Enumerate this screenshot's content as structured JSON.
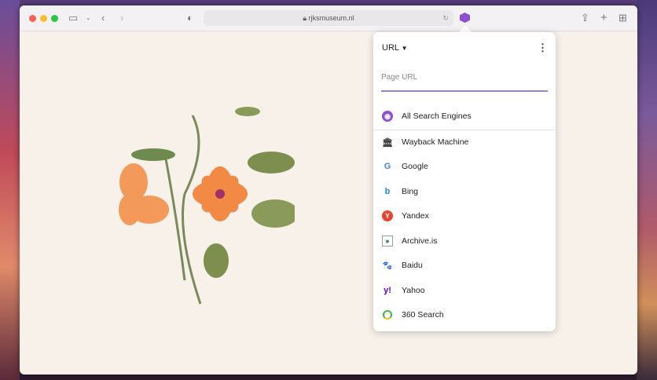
{
  "browser": {
    "url": "rjksmuseum.nl"
  },
  "popup": {
    "mode_label": "URL",
    "input_placeholder": "Page URL",
    "all_engines": "All Search Engines",
    "engines": [
      "Wayback Machine",
      "Google",
      "Bing",
      "Yandex",
      "Archive.is",
      "Baidu",
      "Yahoo",
      "360 Search"
    ]
  },
  "colors": {
    "accent": "#8e88d8",
    "extension": "#8b4fd0",
    "page_bg": "#f8f1ea"
  }
}
